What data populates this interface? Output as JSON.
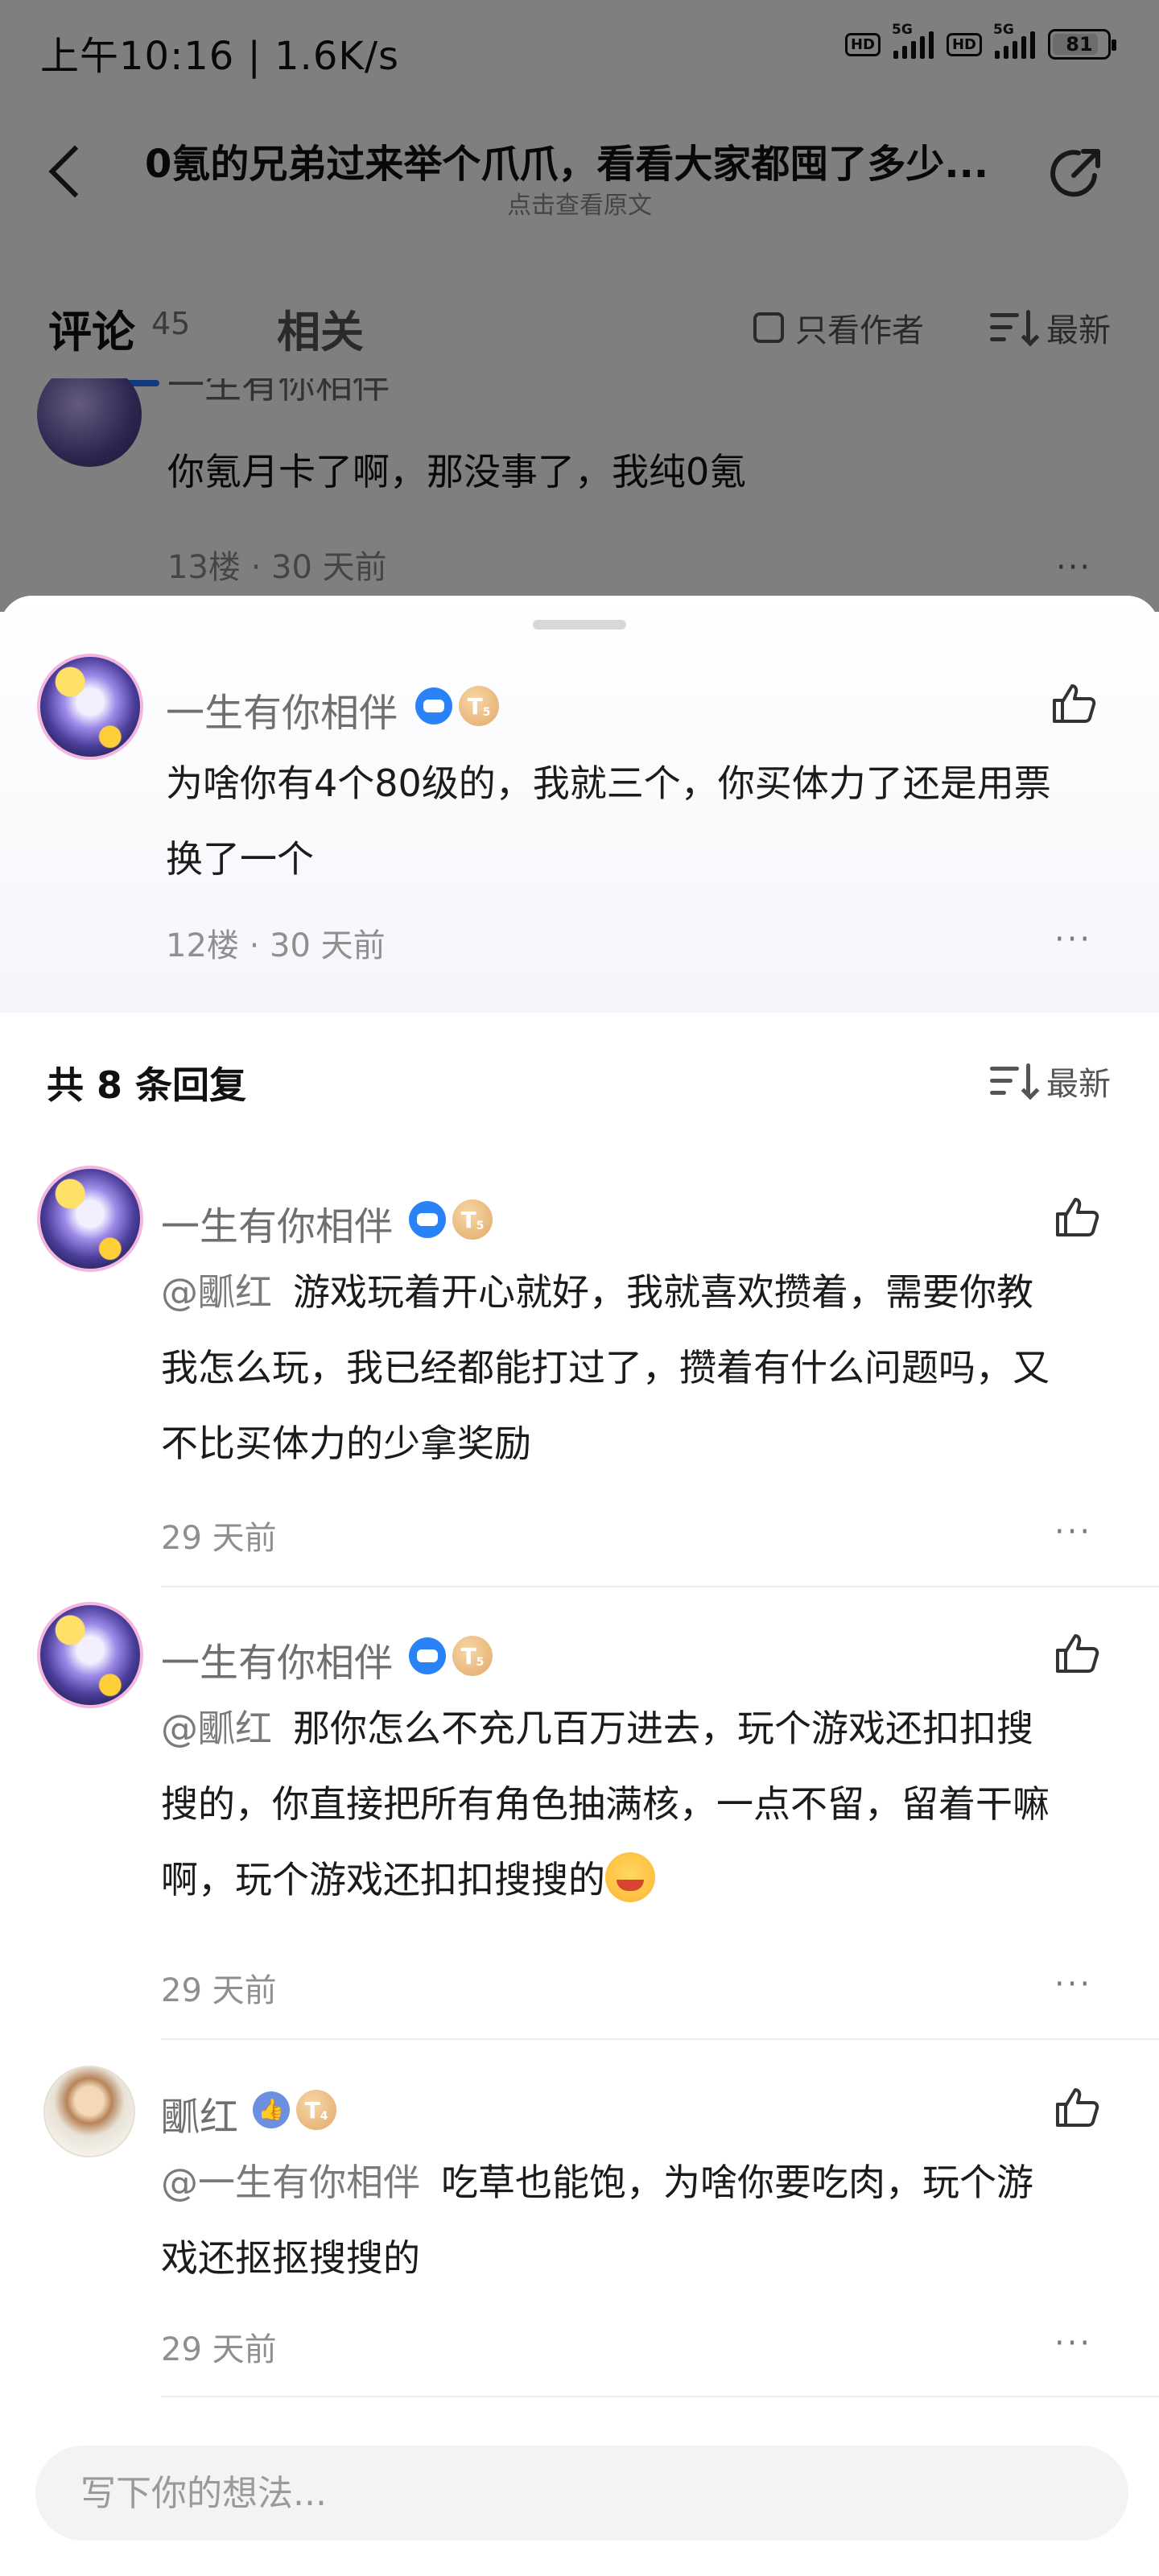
{
  "status_bar": {
    "time": "上午10:16 | 1.6K/s",
    "hd1": "HD",
    "net1": "5G",
    "hd2": "HD",
    "net2": "5G",
    "battery": "81"
  },
  "header": {
    "title": "0氪的兄弟过来举个爪爪，看看大家都囤了多少...",
    "subtitle": "点击查看原文"
  },
  "tabs": {
    "comments_label": "评论",
    "comments_count": "45",
    "related_label": "相关",
    "only_author_label": "只看作者",
    "sort_label": "最新"
  },
  "background_comment": {
    "author": "一生有你相伴",
    "text": "你氪月卡了啊，那没事了，我纯0氪",
    "meta": "13楼 · 30 天前",
    "more": "···"
  },
  "parent_comment": {
    "author": "一生有你相伴",
    "level": "T",
    "level_sub": "5",
    "text_line1": "为啥你有4个80级的，我就三个，你买体力了还是用票",
    "text_line2": "换了一个",
    "meta": "12楼 · 30 天前",
    "more": "···"
  },
  "replies_header": {
    "title": "共 8 条回复",
    "sort_label": "最新"
  },
  "replies": [
    {
      "author": "一生有你相伴",
      "level": "T",
      "level_sub": "5",
      "mention": "@爴红",
      "line1": "游戏玩着开心就好，我就喜欢攒着，需要你教",
      "line2": "我怎么玩，我已经都能打过了，攒着有什么问题吗，又",
      "line3": "不比买体力的少拿奖励",
      "meta": "29 天前",
      "more": "···"
    },
    {
      "author": "一生有你相伴",
      "level": "T",
      "level_sub": "5",
      "mention": "@爴红",
      "line1": "那你怎么不充几百万进去，玩个游戏还扣扣搜",
      "line2": "搜的，你直接把所有角色抽满核，一点不留，留着干嘛",
      "line3": "啊，玩个游戏还扣扣搜搜的",
      "meta": "29 天前",
      "more": "···"
    },
    {
      "author": "爴红",
      "level": "T",
      "level_sub": "4",
      "like_badge": "👍",
      "mention": "@一生有你相伴",
      "line1": "吃草也能饱，为啥你要吃肉，玩个游",
      "line2": "戏还抠抠搜搜的",
      "meta": "29 天前",
      "more": "···"
    }
  ],
  "input": {
    "placeholder": "写下你的想法..."
  },
  "colors": {
    "accent_blue": "#2277ff",
    "badge_blue": "#2a83f6",
    "gold_badge": "#e2a969",
    "muted_text": "#8f8f8f"
  }
}
